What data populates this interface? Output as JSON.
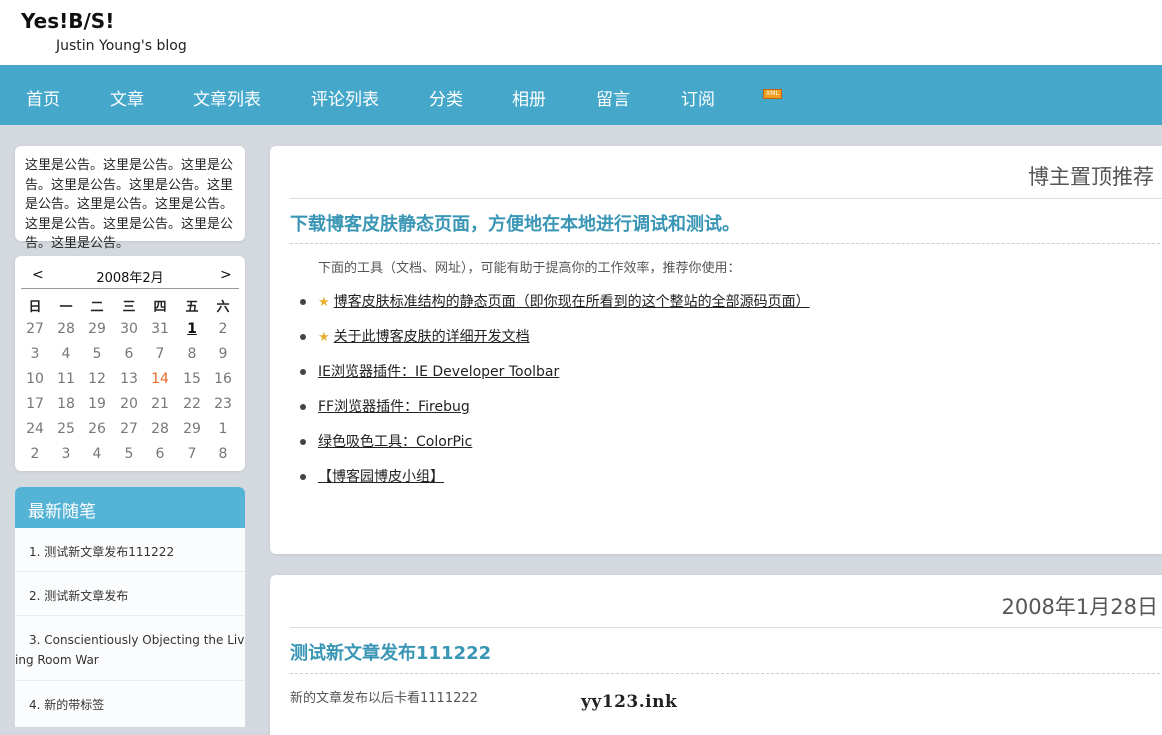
{
  "header": {
    "title": "Yes!B/S!",
    "subtitle": "Justin Young's blog"
  },
  "nav": {
    "items": [
      "首页",
      "文章",
      "文章列表",
      "评论列表",
      "分类",
      "相册",
      "留言",
      "订阅"
    ],
    "rss_icon": "rss-icon",
    "rss_label": "XML"
  },
  "notice": {
    "text": "这里是公告。这里是公告。这里是公告。这里是公告。这里是公告。这里是公告。这里是公告。这里是公告。这里是公告。这里是公告。这里是公告。这里是公告。"
  },
  "calendar": {
    "prev": "<",
    "next": ">",
    "month": "2008年2月",
    "weekdays": [
      "日",
      "一",
      "二",
      "三",
      "四",
      "五",
      "六"
    ],
    "weeks": [
      [
        "27",
        "28",
        "29",
        "30",
        "31",
        "1",
        "2"
      ],
      [
        "3",
        "4",
        "5",
        "6",
        "7",
        "8",
        "9"
      ],
      [
        "10",
        "11",
        "12",
        "13",
        "14",
        "15",
        "16"
      ],
      [
        "17",
        "18",
        "19",
        "20",
        "21",
        "22",
        "23"
      ],
      [
        "24",
        "25",
        "26",
        "27",
        "28",
        "29",
        "1"
      ],
      [
        "2",
        "3",
        "4",
        "5",
        "6",
        "7",
        "8"
      ]
    ],
    "today": "1",
    "highlight": "14",
    "highlight_color": "#e86a28"
  },
  "recent": {
    "title": "最新随笔",
    "items": [
      "1. 测试新文章发布111222",
      "2. 测试新文章发布",
      "3. Conscientiously Objecting the Living Room War",
      "4. 新的带标签"
    ]
  },
  "pinned": {
    "heading": "博主置顶推荐",
    "title": "下载博客皮肤静态页面，方便地在本地进行调试和测试。",
    "intro": "下面的工具（文档、网址），可能有助于提高你的工作效率，推荐你使用：",
    "links": [
      {
        "text": "博客皮肤标准结构的静态页面（即你现在所看到的这个整站的全部源码页面）",
        "starred": true
      },
      {
        "text": "关于此博客皮肤的详细开发文档",
        "starred": true
      },
      {
        "text": "IE浏览器插件：IE Developer Toolbar",
        "starred": false
      },
      {
        "text": "FF浏览器插件：Firebug",
        "starred": false
      },
      {
        "text": "绿色吸色工具：ColorPic",
        "starred": false
      },
      {
        "text": "【博客园博皮小组】",
        "starred": false
      }
    ]
  },
  "post": {
    "date": "2008年1月28日",
    "title": "测试新文章发布111222",
    "body": "新的文章发布以后卡看1111222"
  },
  "watermark": "yy123.ink",
  "colors": {
    "nav_bg": "#45a8cb",
    "title_blue": "#3a96b5",
    "page_bg": "#d4d9df"
  }
}
